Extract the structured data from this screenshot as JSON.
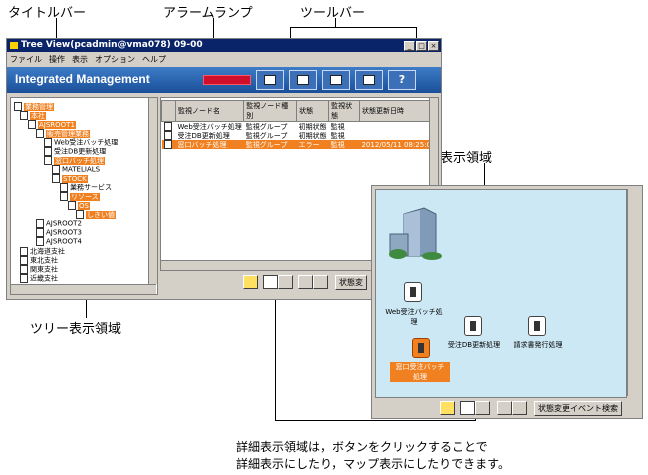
{
  "callouts": {
    "titlebar": "タイトルバー",
    "alarm_lamp": "アラームランプ",
    "toolbar": "ツールバー",
    "detail_area": "詳細表示領域",
    "tree_area": "ツリー表示領域",
    "note_line1": "詳細表示領域は，ボタンをクリックすることで",
    "note_line2": "詳細表示にしたり，マップ表示にしたりできます。"
  },
  "window": {
    "title": "Tree View(pcadmin@vma078) 09-00",
    "menu": [
      "ファイル",
      "操作",
      "表示",
      "オプション",
      "ヘルプ"
    ],
    "app_title": "Integrated Management",
    "toolbar_buttons": [
      "list-icon",
      "chart-icon",
      "grid-icon",
      "card-icon",
      "?"
    ]
  },
  "tree": [
    {
      "label": "業務管理",
      "sel": true
    },
    {
      "label": "本社",
      "sel": true
    },
    {
      "label": "AJSROOT1",
      "sel": true
    },
    {
      "label": "販売管理業務",
      "sel": true
    },
    {
      "label": "Web受注バッチ処理",
      "sel": false
    },
    {
      "label": "受注DB更新処理",
      "sel": false
    },
    {
      "label": "窓口バッチ処理",
      "sel": true
    },
    {
      "label": "MATELIALS",
      "sel": false
    },
    {
      "label": "STOCK",
      "sel": true
    },
    {
      "label": "業務サービス",
      "sel": false
    },
    {
      "label": "リソース",
      "sel": true
    },
    {
      "label": "OS",
      "sel": true
    },
    {
      "label": "しきい値",
      "sel": true
    },
    {
      "label": "AJSROOT2",
      "sel": false
    },
    {
      "label": "AJSROOT3",
      "sel": false
    },
    {
      "label": "AJSROOT4",
      "sel": false
    },
    {
      "label": "北海道支社",
      "sel": false
    },
    {
      "label": "東北支社",
      "sel": false
    },
    {
      "label": "関東支社",
      "sel": false
    },
    {
      "label": "近畿支社",
      "sel": false
    }
  ],
  "list": {
    "headers": [
      "監視ノード名",
      "監視ノード種別",
      "状態",
      "監視状態",
      "状態更新日時"
    ],
    "rows": [
      [
        "Web受注バッチ処理",
        "監視グループ",
        "初期状態",
        "監視",
        ""
      ],
      [
        "受注DB更新処理",
        "監視グループ",
        "初期状態",
        "監視",
        ""
      ],
      [
        "窓口バッチ処理",
        "監視グループ",
        "エラー",
        "監視",
        "2012/05/11 08:25:06"
      ]
    ],
    "highlight_row": 2
  },
  "bottom": {
    "status_button": "状態変",
    "map_status_button": "状態変更イベント検索"
  },
  "map": {
    "nodes": [
      {
        "label1": "Web受注バッチ処",
        "label2": "理"
      },
      {
        "label1": "受注DB更新処理",
        "label2": ""
      },
      {
        "label1": "請求書発行処理",
        "label2": ""
      },
      {
        "label1": "窓口受注バッチ",
        "label2": "処理"
      }
    ]
  },
  "colors": {
    "selection": "#f08020",
    "banner": "#1a4f98",
    "alarm": "#d0102a",
    "map_bg": "#cde8f5"
  }
}
